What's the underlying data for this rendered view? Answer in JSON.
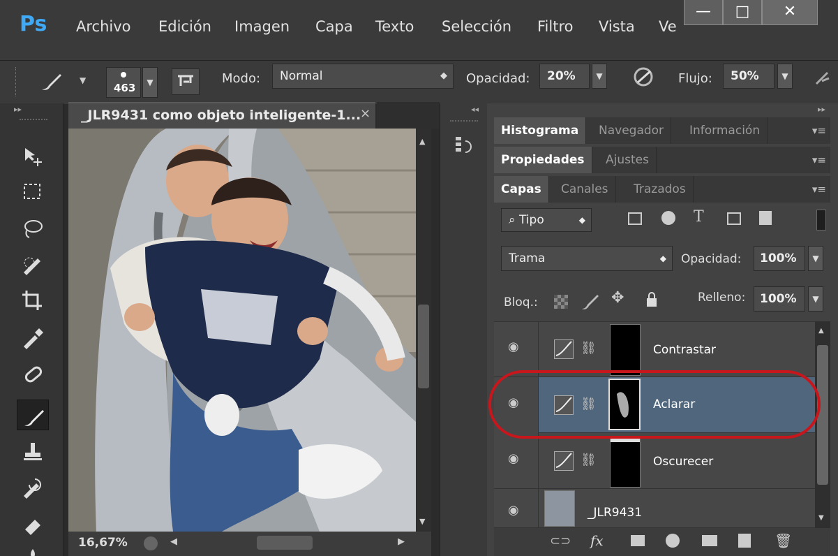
{
  "app": {
    "logo": "Ps",
    "menu": [
      "Archivo",
      "Edición",
      "Imagen",
      "Capa",
      "Texto",
      "Selección",
      "Filtro",
      "Vista",
      "Ve"
    ],
    "window_buttons": [
      "—",
      "□",
      "✕"
    ]
  },
  "options": {
    "brush_size": "463",
    "mode_label": "Modo:",
    "mode_value": "Normal",
    "opacity_label": "Opacidad:",
    "opacity_value": "20%",
    "flow_label": "Flujo:",
    "flow_value": "50%"
  },
  "document": {
    "tab_title": "_JLR9431 como objeto inteligente-1...",
    "close_glyph": "×",
    "zoom": "16,67%"
  },
  "panels": {
    "group1": {
      "tabs": [
        "Histograma",
        "Navegador",
        "Información"
      ]
    },
    "group2": {
      "tabs": [
        "Propiedades",
        "Ajustes"
      ]
    },
    "group3": {
      "tabs": [
        "Capas",
        "Canales",
        "Trazados"
      ]
    },
    "filter_value": "Tipo",
    "blend_mode": "Trama",
    "opacity_label": "Opacidad:",
    "opacity_value": "100%",
    "lock_label": "Bloq.:",
    "fill_label": "Relleno:",
    "fill_value": "100%",
    "layers": [
      {
        "name": "Contrastar",
        "selected": false
      },
      {
        "name": "Aclarar",
        "selected": true
      },
      {
        "name": "Oscurecer",
        "selected": false
      },
      {
        "name": "_JLR9431",
        "selected": false
      }
    ],
    "footer_icons": [
      "link-icon",
      "fx-icon",
      "mask-icon",
      "adjustment-icon",
      "folder-icon",
      "new-layer-icon",
      "trash-icon"
    ]
  },
  "colors": {
    "accent_blue": "#3fa9f5",
    "selected_layer": "#4f667d",
    "annotation_red": "#c8161d"
  }
}
